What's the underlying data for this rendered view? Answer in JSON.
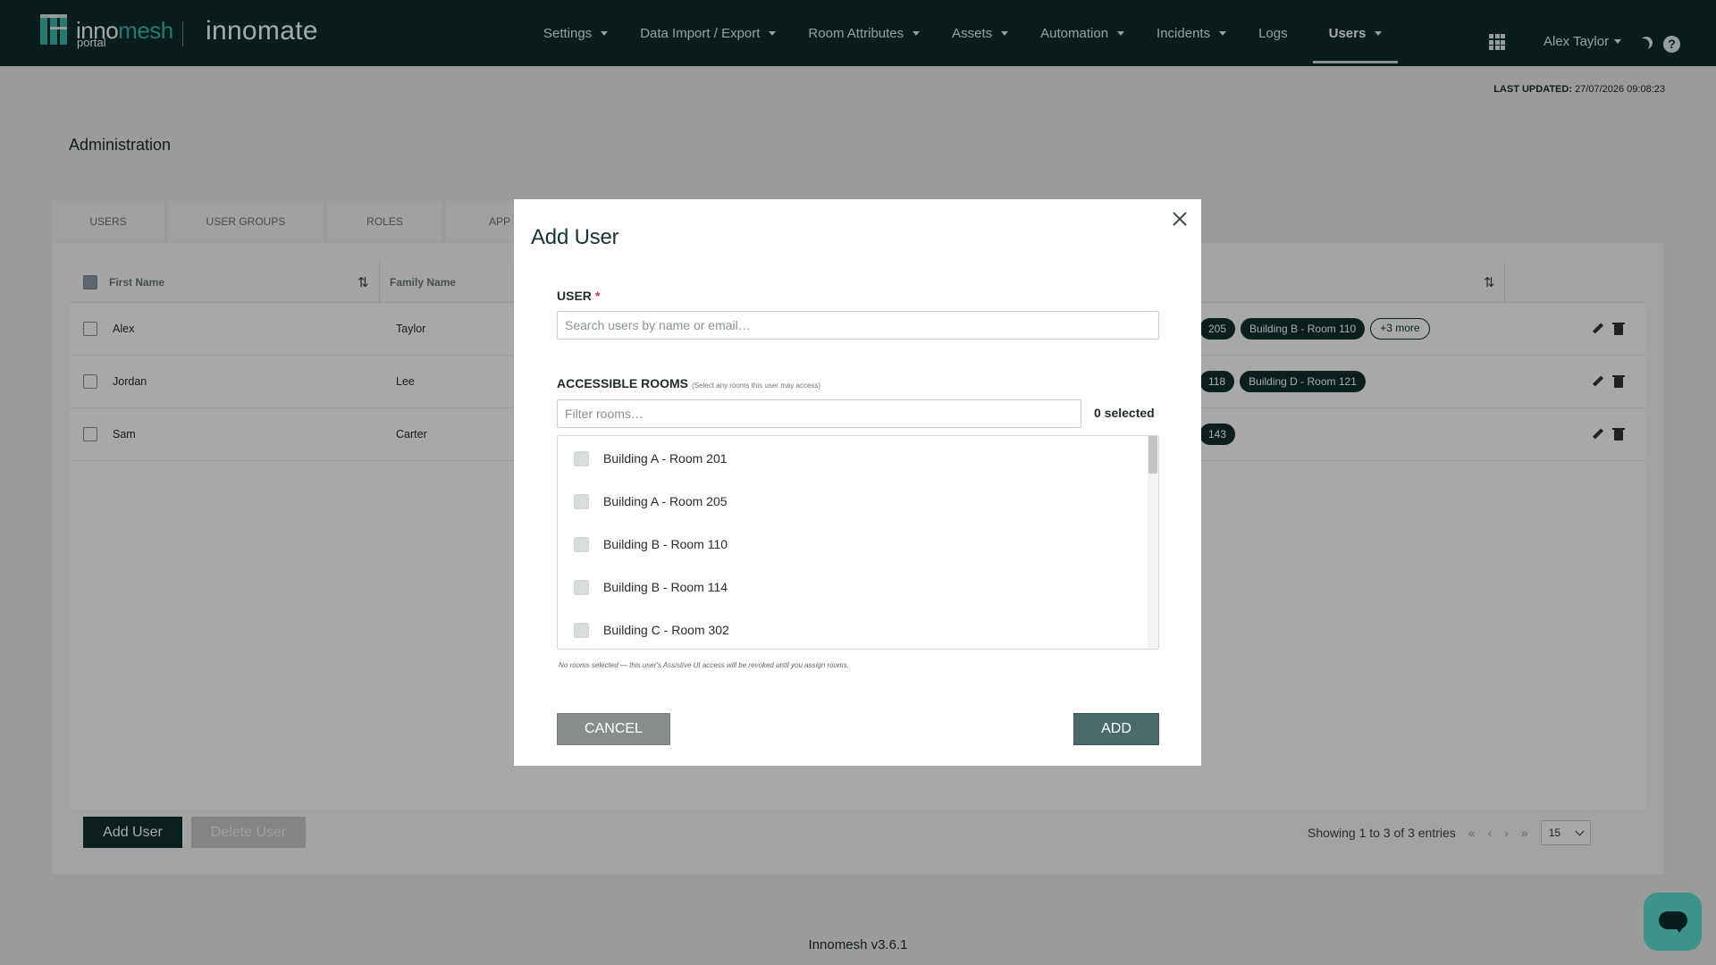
{
  "brand": {
    "name_left": "inno",
    "name_right": "mesh",
    "sub": "portal",
    "product": "innomate",
    "accent_color": "#3bb8a8"
  },
  "nav": {
    "items": [
      {
        "label": "Settings",
        "has_dropdown": true
      },
      {
        "label": "Data Import / Export",
        "has_dropdown": true
      },
      {
        "label": "Room Attributes",
        "has_dropdown": true
      },
      {
        "label": "Assets",
        "has_dropdown": true
      },
      {
        "label": "Automation",
        "has_dropdown": true
      },
      {
        "label": "Incidents",
        "has_dropdown": true
      },
      {
        "label": "Logs",
        "has_dropdown": false
      },
      {
        "label": "Users",
        "has_dropdown": true,
        "active": true
      }
    ],
    "user_name": "Alex Taylor",
    "icons": [
      "apps-grid-icon",
      "moon-icon",
      "help-icon"
    ]
  },
  "last_updated": {
    "label": "LAST UPDATED:",
    "value": "27/07/2026 09:08:23"
  },
  "page": {
    "title": "Administration"
  },
  "tabs": [
    "USERS",
    "USER GROUPS",
    "ROLES",
    "APP"
  ],
  "table": {
    "headers": {
      "first_name": "First Name",
      "family_name": "Family Name"
    },
    "rows": [
      {
        "first": "Alex",
        "family": "Taylor",
        "chips": [
          "205",
          "Building B - Room 110",
          "+3 more"
        ]
      },
      {
        "first": "Jordan",
        "family": "Lee",
        "chips": [
          "118",
          "Building D - Room 121"
        ]
      },
      {
        "first": "Sam",
        "family": "Carter",
        "chips": [
          "143"
        ]
      }
    ]
  },
  "actions": {
    "add_user": "Add User",
    "delete_user": "Delete User"
  },
  "pager": {
    "summary": "Showing 1 to 3 of 3 entries",
    "first": "«",
    "prev": "‹",
    "next": "›",
    "last": "»",
    "page_size": "15"
  },
  "footer": {
    "version": "Innomesh v3.6.1"
  },
  "modal": {
    "title": "Add User",
    "user_label": "USER",
    "required_mark": "*",
    "user_placeholder": "Search users by name or email…",
    "rooms_label": "ACCESSIBLE ROOMS",
    "rooms_hint": "(Select any rooms this user may access)",
    "rooms_filter_placeholder": "Filter rooms…",
    "selected_count": "0 selected",
    "rooms": [
      "Building A - Room 201",
      "Building A - Room 205",
      "Building B - Room 110",
      "Building B - Room 114",
      "Building C - Room 302"
    ],
    "warning": "No rooms selected — this user's Assistive UI access will be revoked until you assign rooms.",
    "cancel_label": "CANCEL",
    "add_label": "ADD"
  },
  "colors": {
    "topbar": "#0f2e2b",
    "primary": "#12302d",
    "chat_widget": "#5fe0d0",
    "required": "#d23b3b"
  }
}
